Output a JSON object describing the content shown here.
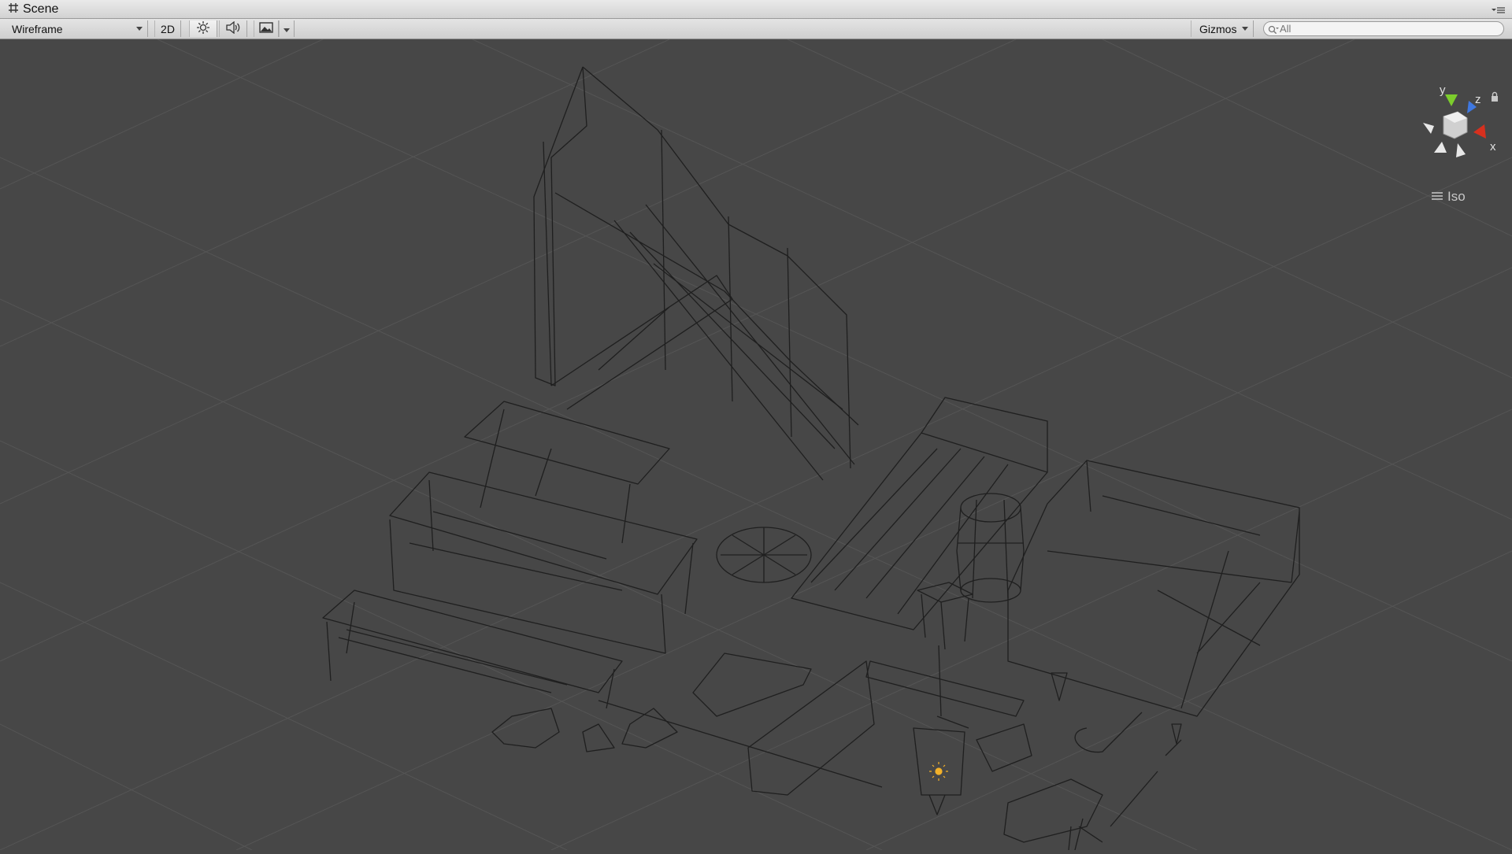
{
  "window": {
    "tab_title": "Scene"
  },
  "toolbar": {
    "shading_mode": "Wireframe",
    "mode_2d_label": "2D",
    "gizmos_label": "Gizmos",
    "search_placeholder": "All"
  },
  "orientation_gizmo": {
    "axis_y": "y",
    "axis_z": "z",
    "axis_x": "x",
    "projection_label": "Iso"
  },
  "colors": {
    "viewport_bg": "#474747",
    "grid": "#555555",
    "wire": "#1f1f1f",
    "axis_y": "#7ccd2c",
    "axis_z": "#3f78e0",
    "axis_x": "#d7301e",
    "light_icon": "#f2b12a"
  }
}
